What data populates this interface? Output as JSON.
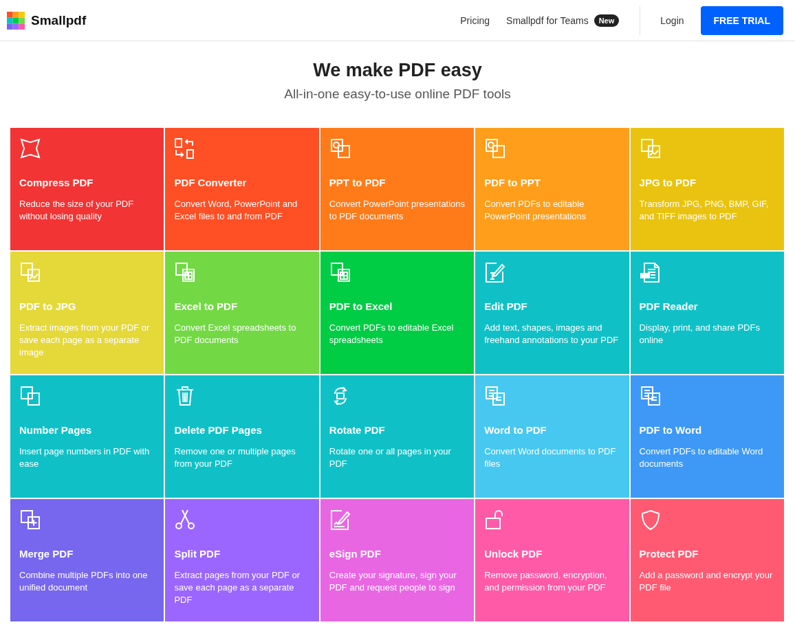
{
  "header": {
    "brand": "Smallpdf",
    "nav": [
      "Pricing",
      "Smallpdf for Teams"
    ],
    "teams_badge": "New",
    "login": "Login",
    "cta": "FREE TRIAL"
  },
  "hero": {
    "title": "We make PDF easy",
    "subtitle": "All-in-one easy-to-use online PDF tools"
  },
  "tools": [
    {
      "kind": "star",
      "title": "Compress PDF",
      "description": "Reduce the size of your PDF without losing quality",
      "color": "#f23434"
    },
    {
      "kind": "convert",
      "title": "PDF Converter",
      "description": "Convert Word, PowerPoint and Excel files to and from PDF",
      "color": "#ff4f24"
    },
    {
      "kind": "chart",
      "title": "PPT to PDF",
      "description": "Convert PowerPoint presentations to PDF documents",
      "color": "#ff7b1a"
    },
    {
      "kind": "chart-back",
      "title": "PDF to PPT",
      "description": "Convert PDFs to editable PowerPoint presentations",
      "color": "#ff9e1a"
    },
    {
      "kind": "image",
      "title": "JPG to PDF",
      "description": "Transform JPG, PNG, BMP, GIF, and TIFF images to PDF",
      "color": "#e9c30f"
    },
    {
      "kind": "image-back",
      "title": "PDF to JPG",
      "description": "Extract images from your PDF or save each page as a separate image",
      "color": "#e5d839"
    },
    {
      "kind": "grid",
      "title": "Excel to PDF",
      "description": "Convert Excel spreadsheets to PDF documents",
      "color": "#72d944"
    },
    {
      "kind": "grid-back",
      "title": "PDF to Excel",
      "description": "Convert PDFs to editable Excel spreadsheets",
      "color": "#00cc44"
    },
    {
      "kind": "edit",
      "title": "Edit PDF",
      "description": "Add text, shapes, images and freehand annotations to your PDF",
      "color": "#0fc1c6"
    },
    {
      "kind": "reader",
      "title": "PDF Reader",
      "description": "Display, print, and share PDFs online",
      "color": "#0fc1c6"
    },
    {
      "kind": "pages",
      "title": "Number Pages",
      "description": "Insert page numbers in PDF with ease",
      "color": "#0fc1c6"
    },
    {
      "kind": "trash",
      "title": "Delete PDF Pages",
      "description": "Remove one or multiple pages from your PDF",
      "color": "#0fc1c6"
    },
    {
      "kind": "rotate",
      "title": "Rotate PDF",
      "description": "Rotate one or all pages in your PDF",
      "color": "#0fc1c6"
    },
    {
      "kind": "doc",
      "title": "Word to PDF",
      "description": "Convert Word documents to PDF files",
      "color": "#47c8f0"
    },
    {
      "kind": "doc-back",
      "title": "PDF to Word",
      "description": "Convert PDFs to editable Word documents",
      "color": "#3d99f5"
    },
    {
      "kind": "merge",
      "title": "Merge PDF",
      "description": "Combine multiple PDFs into one unified document",
      "color": "#7766ee"
    },
    {
      "kind": "scissors",
      "title": "Split PDF",
      "description": "Extract pages from your PDF or save each page as a separate PDF",
      "color": "#9b66ff"
    },
    {
      "kind": "sign",
      "title": "eSign PDF",
      "description": "Create your signature, sign your PDF and request people to sign",
      "color": "#e866e2"
    },
    {
      "kind": "unlock",
      "title": "Unlock PDF",
      "description": "Remove password, encryption, and permission from your PDF",
      "color": "#ff5aa8"
    },
    {
      "kind": "shield",
      "title": "Protect PDF",
      "description": "Add a password and encrypt your PDF file",
      "color": "#ff5a72"
    }
  ]
}
